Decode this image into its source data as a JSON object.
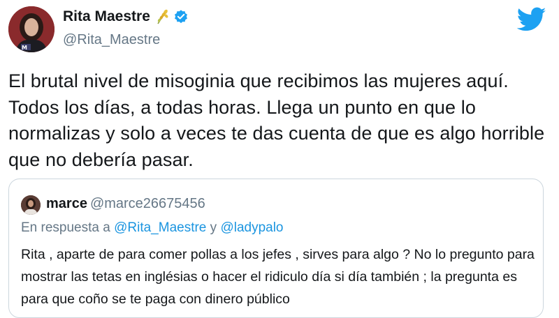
{
  "author": {
    "display_name": "Rita Maestre",
    "handle": "@Rita_Maestre",
    "name_emoji": "wheat-flower-emoji",
    "verified_icon": "verified-badge-icon"
  },
  "tweet": {
    "text": "El brutal nivel de misoginia que recibimos las mujeres aquí. Todos los días, a todas horas. Llega un punto en que lo normalizas y solo a veces te das cuenta de que es algo horrible que no debería pasar."
  },
  "quoted_tweet": {
    "display_name": "marce",
    "handle": "@marce26675456",
    "reply_prefix": "En respuesta a",
    "reply_user_1": "@Rita_Maestre",
    "reply_joiner": "y",
    "reply_user_2": "@ladypalo",
    "text": "Rita , aparte de para comer pollas a los jefes , sirves para algo ? No lo pregunto para mostrar las tetas en inglésias o hacer el ridiculo día si día también ; la pregunta es para que coño se te paga con dinero público"
  },
  "colors": {
    "twitter_blue": "#1da1f2",
    "link_blue": "#1b95e0",
    "secondary_text": "#657786",
    "border": "#ccd6dd"
  }
}
